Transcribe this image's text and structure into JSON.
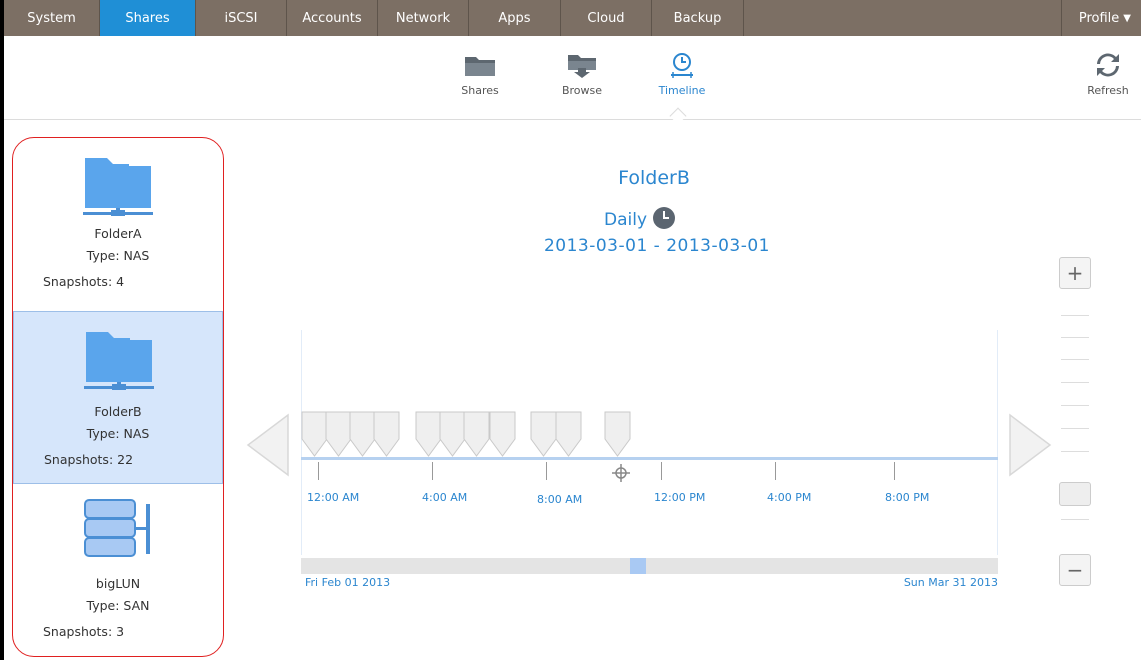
{
  "nav": {
    "tabs": [
      {
        "label": "System",
        "active": false
      },
      {
        "label": "Shares",
        "active": true
      },
      {
        "label": "iSCSI",
        "active": false
      },
      {
        "label": "Accounts",
        "active": false
      },
      {
        "label": "Network",
        "active": false
      },
      {
        "label": "Apps",
        "active": false
      },
      {
        "label": "Cloud",
        "active": false
      },
      {
        "label": "Backup",
        "active": false
      }
    ],
    "profile": "Profile"
  },
  "toolbar": {
    "shares": "Shares",
    "browse": "Browse",
    "timeline": "Timeline",
    "refresh": "Refresh"
  },
  "shares": [
    {
      "name": "FolderA",
      "type": "Type: NAS",
      "snapshots": "Snapshots: 4",
      "icon": "nas-folder-icon",
      "selected": false
    },
    {
      "name": "FolderB",
      "type": "Type: NAS",
      "snapshots": "Snapshots: 22",
      "icon": "nas-folder-icon",
      "selected": true
    },
    {
      "name": "bigLUN",
      "type": "Type: SAN",
      "snapshots": "Snapshots: 3",
      "icon": "san-lun-icon",
      "selected": false
    }
  ],
  "timeline": {
    "title": "FolderB",
    "frequency": "Daily",
    "range": "2013-03-01  -  2013-03-01",
    "tick_labels": [
      "12:00 AM",
      "4:00 AM",
      "8:00 AM",
      "12:00 PM",
      "4:00 PM",
      "8:00 PM"
    ],
    "range_start": "Fri Feb 01 2013",
    "range_end": "Sun Mar 31 2013"
  },
  "colors": {
    "nav_bg": "#7c6f64",
    "nav_active": "#1f8fd6",
    "accent": "#2b86cf",
    "selected_row": "#d6e6fb",
    "highlight_border": "#e02020"
  }
}
